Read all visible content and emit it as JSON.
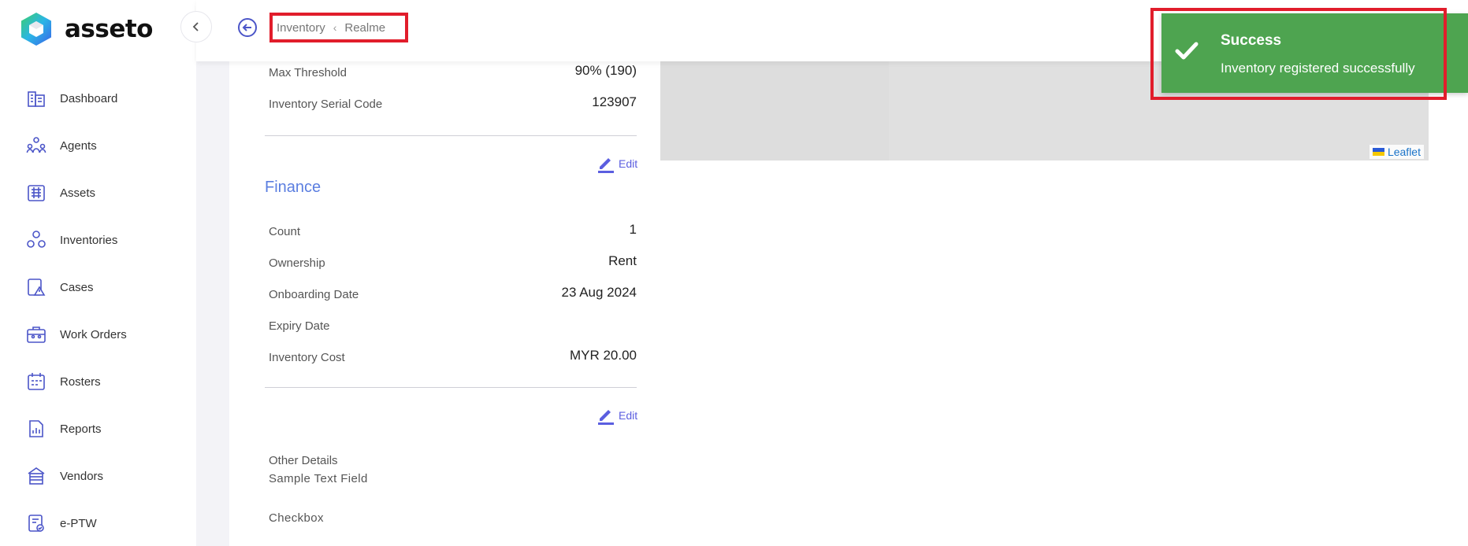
{
  "app": {
    "name": "asseto"
  },
  "sidebar": {
    "items": [
      {
        "label": "Dashboard",
        "icon": "dashboard-icon"
      },
      {
        "label": "Agents",
        "icon": "agents-icon"
      },
      {
        "label": "Assets",
        "icon": "assets-icon"
      },
      {
        "label": "Inventories",
        "icon": "inventories-icon"
      },
      {
        "label": "Cases",
        "icon": "cases-icon"
      },
      {
        "label": "Work Orders",
        "icon": "work-orders-icon"
      },
      {
        "label": "Rosters",
        "icon": "rosters-icon"
      },
      {
        "label": "Reports",
        "icon": "reports-icon"
      },
      {
        "label": "Vendors",
        "icon": "vendors-icon"
      },
      {
        "label": "e-PTW",
        "icon": "eptw-icon"
      }
    ]
  },
  "header": {
    "breadcrumb": {
      "parent": "Inventory",
      "current": "Realme"
    }
  },
  "details": {
    "max_threshold_label": "Max Threshold",
    "max_threshold_value": "90% (190)",
    "serial_code_label": "Inventory Serial Code",
    "serial_code_value": "123907"
  },
  "edit_label": "Edit",
  "finance": {
    "title": "Finance",
    "count_label": "Count",
    "count_value": "1",
    "ownership_label": "Ownership",
    "ownership_value": "Rent",
    "onboarding_label": "Onboarding Date",
    "onboarding_value": "23 Aug 2024",
    "expiry_label": "Expiry Date",
    "expiry_value": "",
    "cost_label": "Inventory Cost",
    "cost_value": "MYR 20.00"
  },
  "other": {
    "title": "Other Details",
    "sample_text_label": "Sample Text Field",
    "checkbox_label": "Checkbox"
  },
  "map": {
    "attribution": "Leaflet"
  },
  "toast": {
    "title": "Success",
    "message": "Inventory registered successfully"
  },
  "colors": {
    "accent": "#5b5ee0",
    "success": "#4ea450",
    "highlight": "#e11d2b"
  }
}
